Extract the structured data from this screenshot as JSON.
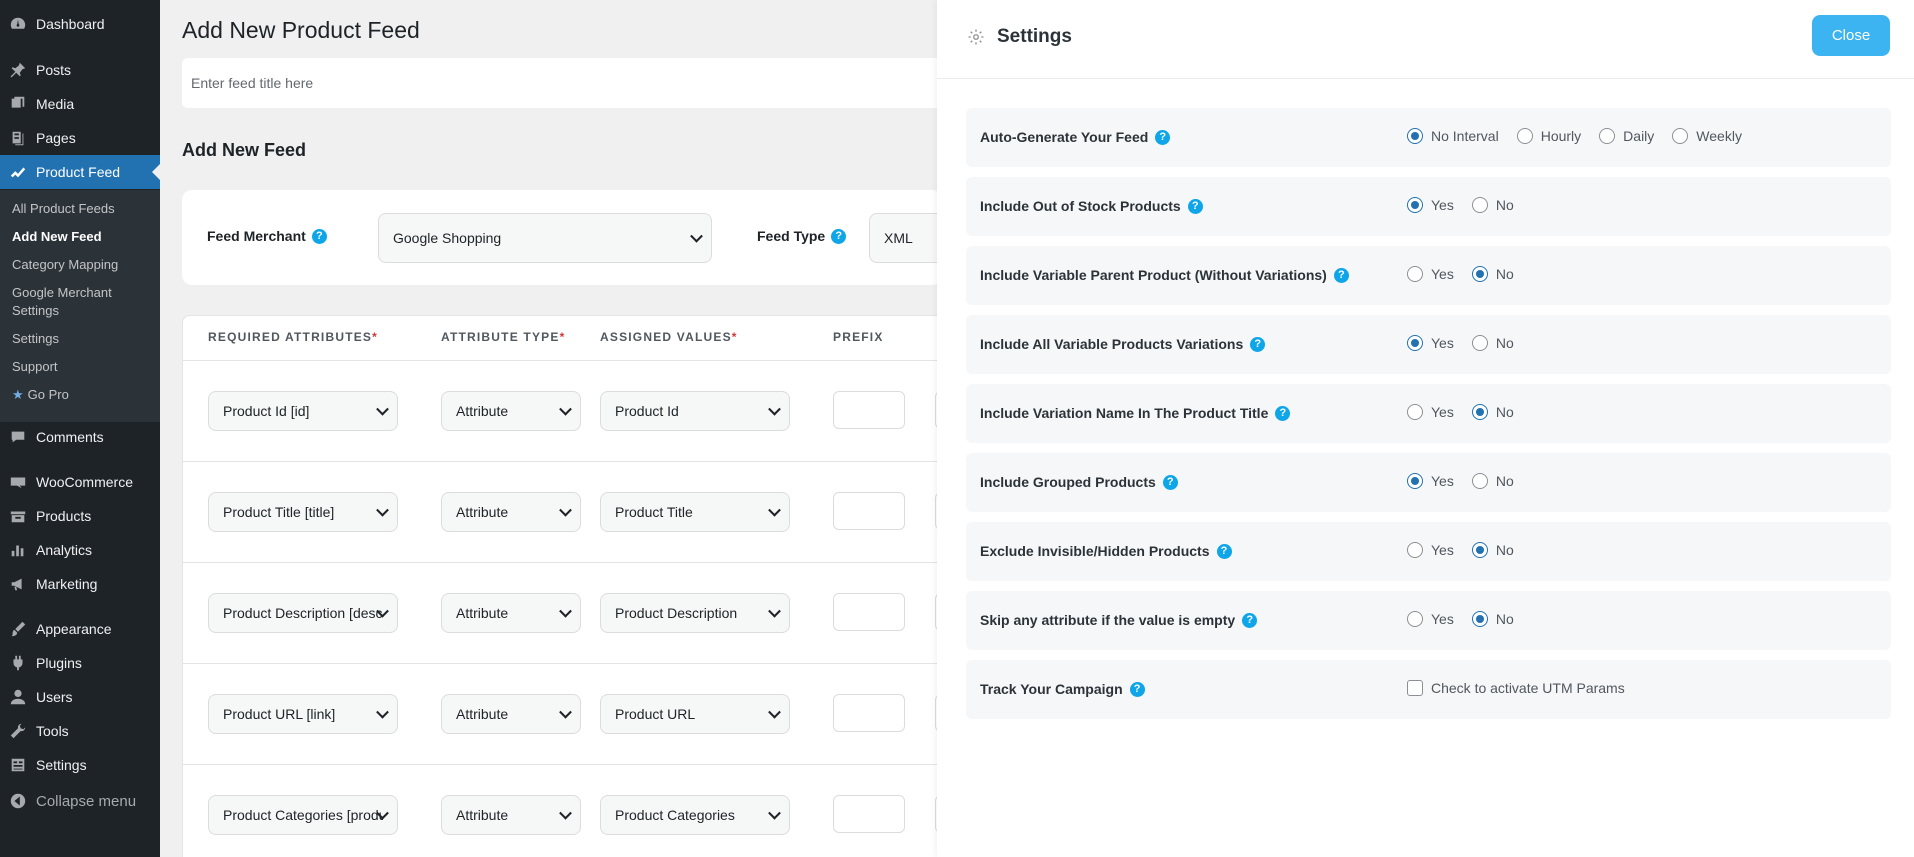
{
  "sidebar": {
    "menu": [
      {
        "label": "Dashboard",
        "icon": "dashboard-icon"
      },
      {
        "label": "Posts",
        "icon": "pin-icon"
      },
      {
        "label": "Media",
        "icon": "media-icon"
      },
      {
        "label": "Pages",
        "icon": "pages-icon"
      },
      {
        "label": "Product Feed",
        "icon": "feed-icon"
      },
      {
        "label": "Comments",
        "icon": "comment-icon"
      },
      {
        "label": "WooCommerce",
        "icon": "woo-icon"
      },
      {
        "label": "Products",
        "icon": "products-icon"
      },
      {
        "label": "Analytics",
        "icon": "analytics-icon"
      },
      {
        "label": "Marketing",
        "icon": "megaphone-icon"
      },
      {
        "label": "Appearance",
        "icon": "brush-icon"
      },
      {
        "label": "Plugins",
        "icon": "plugin-icon"
      },
      {
        "label": "Users",
        "icon": "user-icon"
      },
      {
        "label": "Tools",
        "icon": "wrench-icon"
      },
      {
        "label": "Settings",
        "icon": "settings-icon"
      },
      {
        "label": "Collapse menu",
        "icon": "collapse-icon"
      }
    ],
    "submenu": [
      "All Product Feeds",
      "Add New Feed",
      "Category Mapping",
      "Google Merchant",
      "Settings",
      "Support",
      "Go Pro"
    ],
    "submenu_gm_line2": "Settings"
  },
  "main": {
    "page_title": "Add New Product Feed",
    "title_placeholder": "Enter feed title here",
    "section_title": "Add New Feed",
    "merchant_label": "Feed Merchant",
    "merchant_value": "Google Shopping",
    "feed_type_label": "Feed Type",
    "feed_type_value": "XML",
    "table": {
      "headers": [
        "REQUIRED ATTRIBUTES",
        "ATTRIBUTE TYPE",
        "ASSIGNED VALUES",
        "PREFIX"
      ],
      "required_mark": "*",
      "rows": [
        {
          "attribute": "Product Id [id]",
          "type": "Attribute",
          "value": "Product Id"
        },
        {
          "attribute": "Product Title [title]",
          "type": "Attribute",
          "value": "Product Title"
        },
        {
          "attribute": "Product Description [description]",
          "type": "Attribute",
          "value": "Product Description"
        },
        {
          "attribute": "Product URL [link]",
          "type": "Attribute",
          "value": "Product URL"
        },
        {
          "attribute": "Product Categories [product_type]",
          "type": "Attribute",
          "value": "Product Categories"
        }
      ]
    }
  },
  "settings": {
    "title": "Settings",
    "close_label": "Close",
    "help_glyph": "?",
    "rows": [
      {
        "label": "Auto-Generate Your Feed",
        "options": [
          "No Interval",
          "Hourly",
          "Daily",
          "Weekly"
        ],
        "selected": 0
      },
      {
        "label": "Include Out of Stock Products",
        "options": [
          "Yes",
          "No"
        ],
        "selected": 0
      },
      {
        "label": "Include Variable Parent Product (Without Variations)",
        "options": [
          "Yes",
          "No"
        ],
        "selected": 1
      },
      {
        "label": "Include All Variable Products Variations",
        "options": [
          "Yes",
          "No"
        ],
        "selected": 0
      },
      {
        "label": "Include Variation Name In The Product Title",
        "options": [
          "Yes",
          "No"
        ],
        "selected": 1
      },
      {
        "label": "Include Grouped Products",
        "options": [
          "Yes",
          "No"
        ],
        "selected": 0
      },
      {
        "label": "Exclude Invisible/Hidden Products",
        "options": [
          "Yes",
          "No"
        ],
        "selected": 1
      },
      {
        "label": "Skip any attribute if the value is empty",
        "options": [
          "Yes",
          "No"
        ],
        "selected": 1
      },
      {
        "label": "Track Your Campaign",
        "checkbox_label": "Check to activate UTM Params",
        "checked": false
      }
    ]
  },
  "colors": {
    "sidebar_bg": "#1d2327",
    "current_menu": "#2271b1",
    "close_button": "#3db4f2",
    "help_icon": "#0ea5e9",
    "radio_checked": "#2271b1"
  }
}
